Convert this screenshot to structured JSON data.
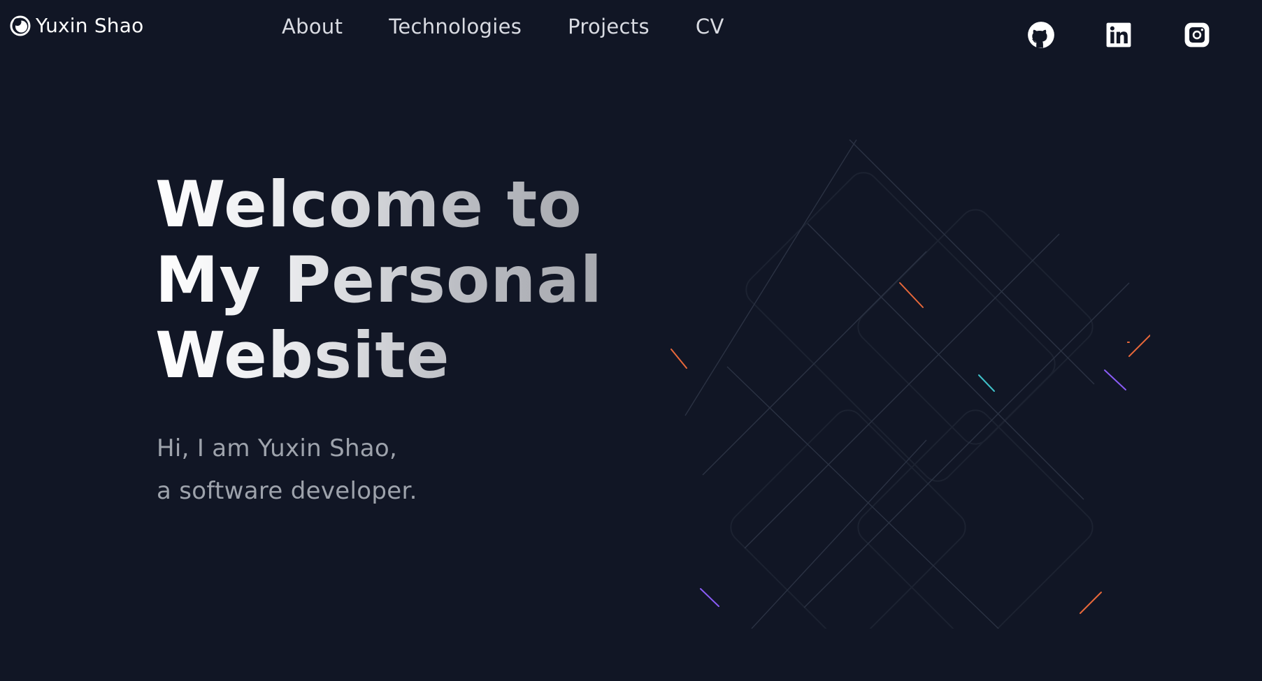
{
  "header": {
    "brand_name": "Yuxin Shao",
    "brand_icon": "crescent-logo-icon",
    "nav": [
      {
        "label": "About"
      },
      {
        "label": "Technologies"
      },
      {
        "label": "Projects"
      },
      {
        "label": "CV"
      }
    ],
    "socials": [
      {
        "icon": "github-icon"
      },
      {
        "icon": "linkedin-icon"
      },
      {
        "icon": "instagram-icon"
      }
    ]
  },
  "hero": {
    "title_lines": [
      "Welcome to",
      "My Personal",
      "Website"
    ],
    "subtitle_lines": [
      "Hi, I am Yuxin Shao,",
      "a software developer."
    ]
  },
  "colors": {
    "background": "#111625",
    "text_primary": "#ffffff",
    "nav_text": "#d9dbe2",
    "subtitle_text": "#9ea3ac",
    "accent_orange": "#e8683a",
    "accent_cyan": "#3fc1c9",
    "accent_purple": "#8a5cf6"
  }
}
